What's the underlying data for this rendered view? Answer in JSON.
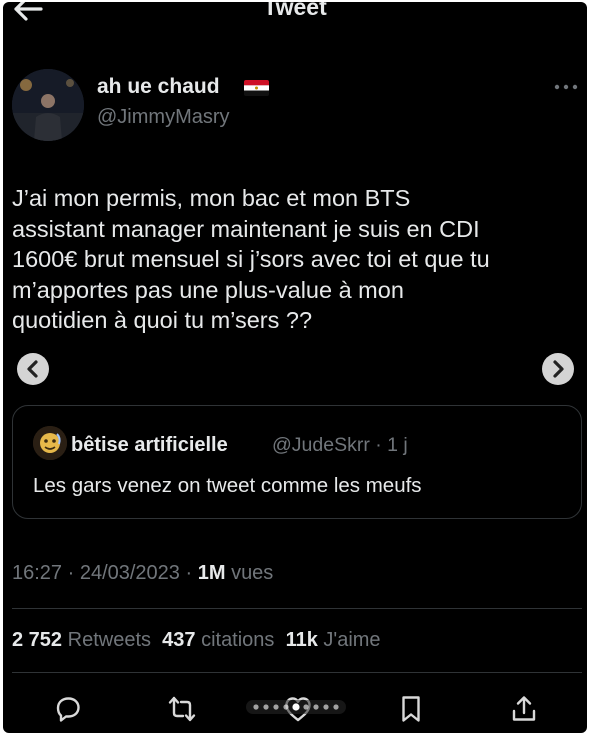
{
  "header": {
    "title": "Tweet"
  },
  "author": {
    "display_name": "ah ue chaud",
    "handle": "@JimmyMasry"
  },
  "tweet": {
    "lines": [
      "J’ai mon permis, mon bac et mon BTS",
      "assistant manager maintenant je suis en CDI",
      "1600€ brut mensuel si j’sors avec toi et que tu",
      "m’apportes pas une plus-value à mon",
      "quotidien à quoi tu m’sers ??"
    ]
  },
  "quote": {
    "name": "bêtise artificielle",
    "handle_time": "@JudeSkrr · 1 j",
    "text": "Les gars venez on tweet comme les meufs"
  },
  "meta": {
    "timestamp": "16:27 · 24/03/2023 ·",
    "views_count": "1M",
    "views_label": "vues"
  },
  "stats": {
    "retweets_count": "2 752",
    "retweets_label": "Retweets",
    "quotes_count": "437",
    "quotes_label": "citations",
    "likes_count": "11k",
    "likes_label": "J'aime"
  },
  "carousel": {
    "dot_count": 9,
    "active_index": 4
  },
  "icons": {
    "back": "arrow-left-icon",
    "more": "more-horizontal-icon",
    "reply": "reply-icon",
    "retweet": "retweet-icon",
    "like": "heart-icon",
    "bookmark": "bookmark-icon",
    "share": "share-icon"
  },
  "colors": {
    "background": "#000000",
    "text": "#e7e9ea",
    "muted": "#71767b",
    "border": "#2f3336"
  }
}
